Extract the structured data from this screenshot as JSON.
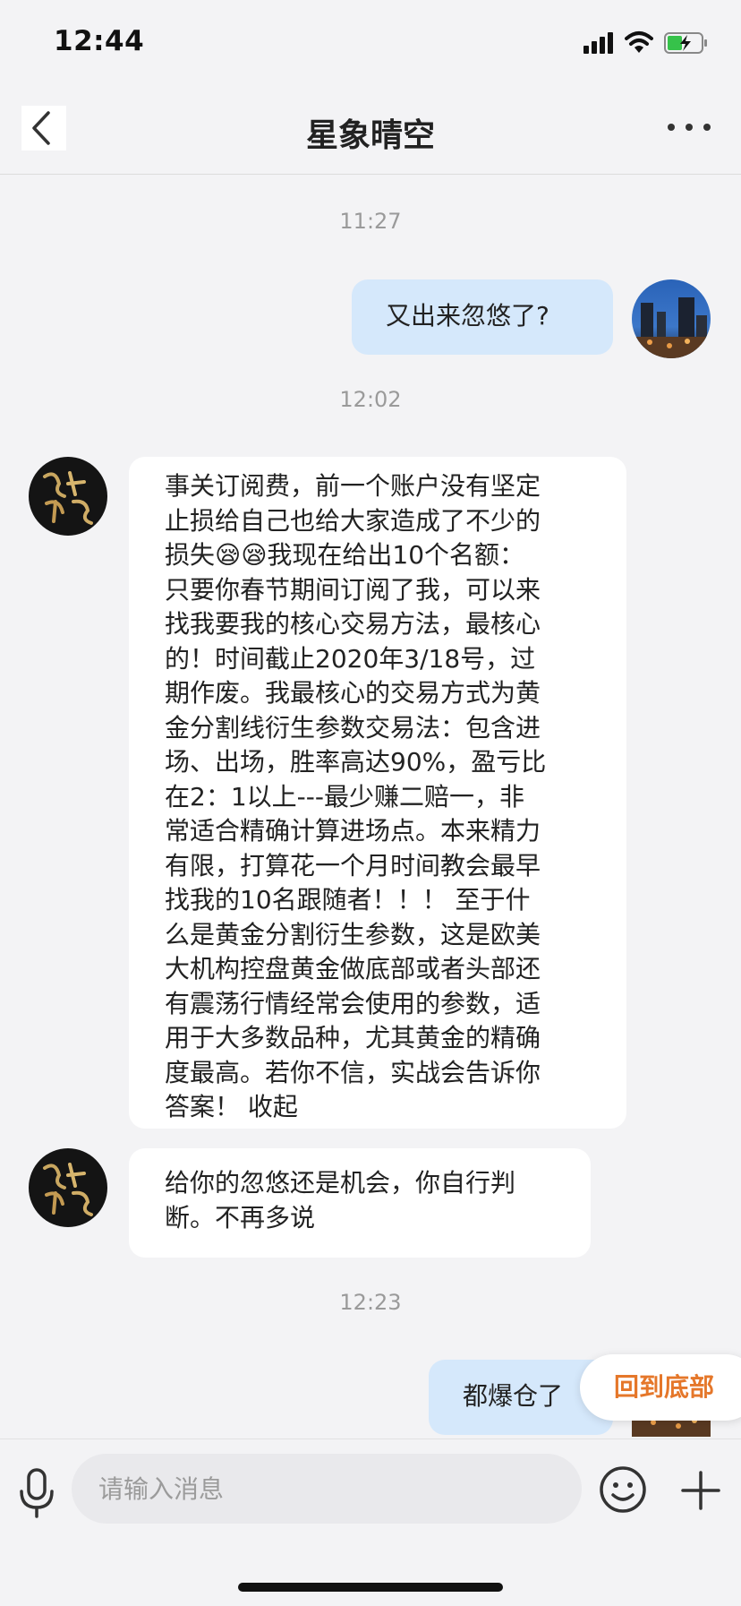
{
  "status_bar": {
    "time": "12:44",
    "icons": [
      "cellular-signal-icon",
      "wifi-icon",
      "battery-charging-icon"
    ]
  },
  "nav": {
    "back_icon": "chevron-left-icon",
    "title": "星象晴空",
    "more_icon": "more-dots-icon"
  },
  "chat": {
    "timestamps": [
      "11:27",
      "12:02",
      "12:23"
    ],
    "messages": [
      {
        "direction": "outgoing",
        "text": "又出来忽悠了?"
      },
      {
        "direction": "incoming",
        "lines": [
          "事关订阅费，前一个账户没有坚定",
          "止损给自己也给大家造成了不少的",
          "损失😪😪我现在给出10个名额：",
          "只要你春节期间订阅了我，可以来",
          "找我要我的核心交易方法，最核心",
          "的！时间截止2020年3/18号，过",
          "期作废。我最核心的交易方式为黄",
          "金分割线衍生参数交易法：包含进",
          "场、出场，胜率高达90%，盈亏比",
          "在2：1以上---最少赚二赔一，非",
          "常适合精确计算进场点。本来精力",
          "有限，打算花一个月时间教会最早",
          "找我的10名跟随者！！！ 至于什",
          "么是黄金分割衍生参数，这是欧美",
          "大机构控盘黄金做底部或者头部还",
          "有震荡行情经常会使用的参数，适",
          "用于大多数品种，尤其黄金的精确",
          "度最高。若你不信，实战会告诉你",
          "答案！  收起"
        ]
      },
      {
        "direction": "incoming",
        "lines": [
          "给你的忽悠还是机会，你自行判",
          "断。不再多说"
        ]
      },
      {
        "direction": "outgoing",
        "text": "都爆仓了"
      }
    ]
  },
  "back_to_bottom": {
    "label": "回到底部"
  },
  "input_bar": {
    "mic_icon": "microphone-icon",
    "placeholder": "请输入消息",
    "emoji_icon": "emoji-icon",
    "plus_icon": "plus-icon"
  }
}
